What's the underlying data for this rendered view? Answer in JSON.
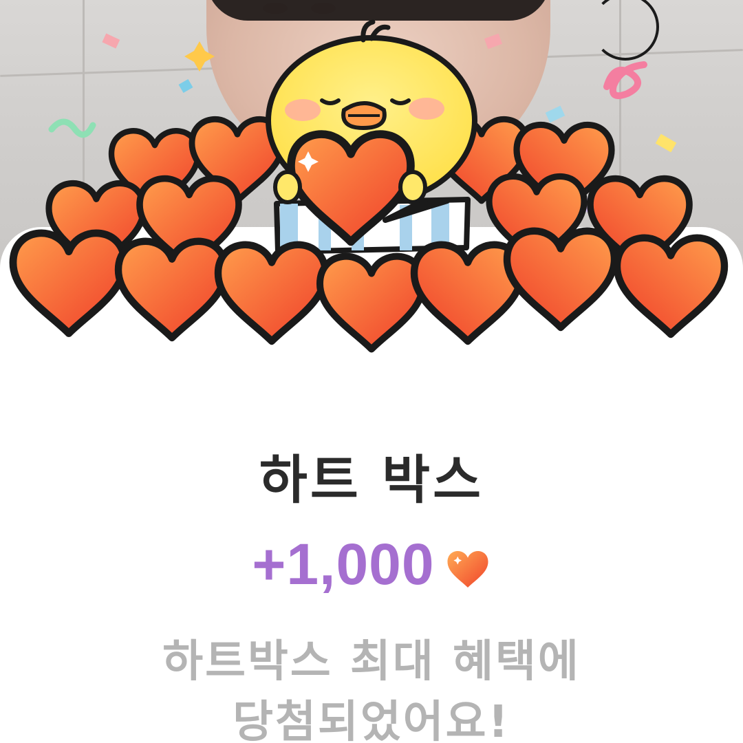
{
  "reward": {
    "title": "하트 박스",
    "amount": "+1,000",
    "currency_icon": "heart-icon",
    "message_line1": "하트박스 최대 혜택에",
    "message_line2": "당첨되었어요!"
  },
  "colors": {
    "amount": "#a56fd0",
    "title": "#2b2b2b",
    "message": "#b4b4b4",
    "heart_top": "#ff9a4a",
    "heart_bottom": "#f0432a",
    "chick": "#ffe86a"
  }
}
